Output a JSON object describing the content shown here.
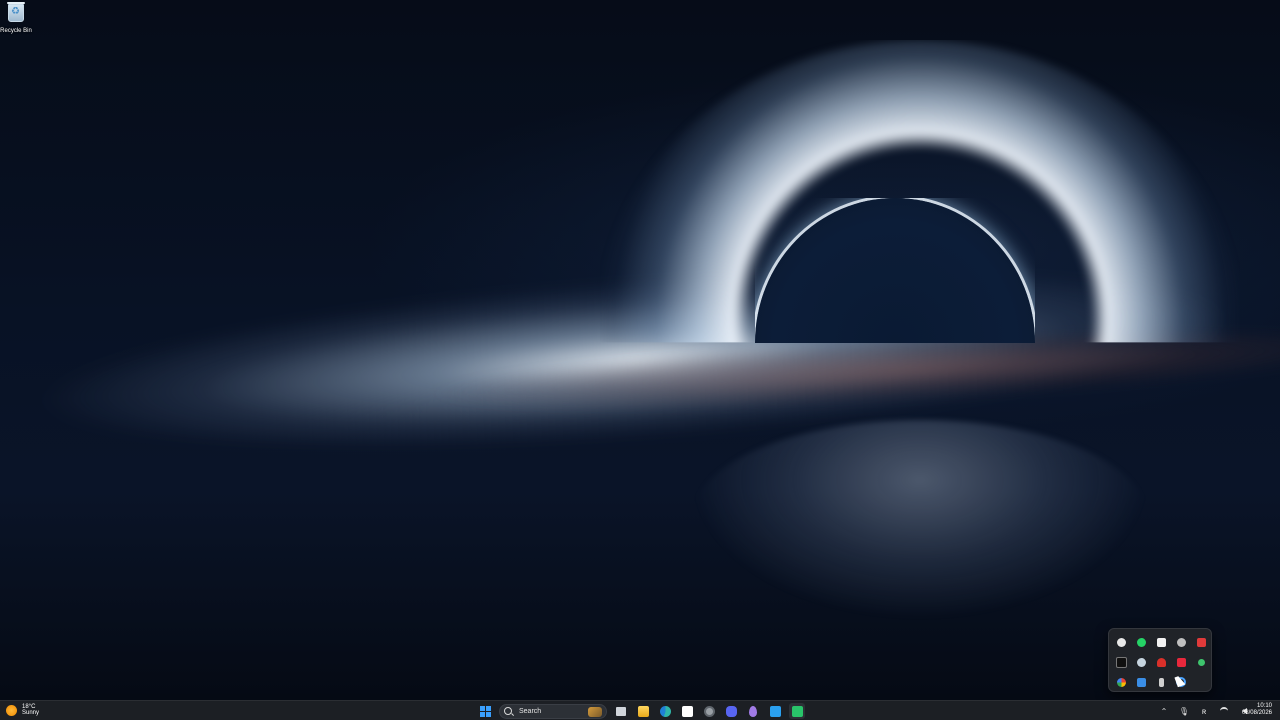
{
  "desktop": {
    "icons": [
      {
        "label": "Recycle Bin",
        "icon": "recycle-bin-icon"
      }
    ]
  },
  "tray_overflow": {
    "icons": [
      {
        "icon": "chatgpt-icon",
        "color": "#e8e8e8"
      },
      {
        "icon": "whatsapp-icon",
        "color": "#25d366"
      },
      {
        "icon": "app-white-icon",
        "color": "#f2f2f2"
      },
      {
        "icon": "app-gray-icon",
        "color": "#bfbfbf"
      },
      {
        "icon": "app-red-icon",
        "color": "#e03a3a"
      },
      {
        "icon": "app-black-icon",
        "color": "#101010"
      },
      {
        "icon": "steam-icon",
        "color": "#c6d4df"
      },
      {
        "icon": "app-red-small-icon",
        "color": "#d9302a"
      },
      {
        "icon": "app-red-square-icon",
        "color": "#e8283c"
      },
      {
        "icon": "app-green-dot-icon",
        "color": "#3ec46d"
      },
      {
        "icon": "google-icon",
        "color": "#f4b400"
      },
      {
        "icon": "app-blue-icon",
        "color": "#3a8ee6"
      },
      {
        "icon": "usb-icon",
        "color": "#d0d0d0"
      },
      {
        "icon": "app-blue-ring-icon",
        "color": "#4aa3ff"
      }
    ]
  },
  "taskbar": {
    "weather": {
      "temp": "18°C",
      "condition": "Sunny",
      "icon": "sun-icon"
    },
    "search": {
      "label": "Search"
    },
    "apps": [
      {
        "icon": "task-view-icon",
        "color": "#d0d4da"
      },
      {
        "icon": "file-explorer-icon",
        "color": "#f5c542"
      },
      {
        "icon": "edge-icon",
        "color": "#2fb5a8"
      },
      {
        "icon": "microsoft-store-icon",
        "color": "#ffffff"
      },
      {
        "icon": "settings-icon",
        "color": "#9aa0a6"
      },
      {
        "icon": "discord-icon",
        "color": "#5865f2"
      },
      {
        "icon": "visual-studio-icon",
        "color": "#a17be6"
      },
      {
        "icon": "vscode-icon",
        "color": "#2aa0f0"
      },
      {
        "icon": "app-green-icon",
        "color": "#29c46a"
      }
    ],
    "tray": {
      "chevron": "⌃",
      "mic": "🎙",
      "lang": "ʀ"
    },
    "clock": {
      "time": "10:10",
      "date": "08/08/2026"
    }
  },
  "colors": {
    "taskbar_bg": "#1c1f24",
    "accent": "#3aa0ff"
  }
}
